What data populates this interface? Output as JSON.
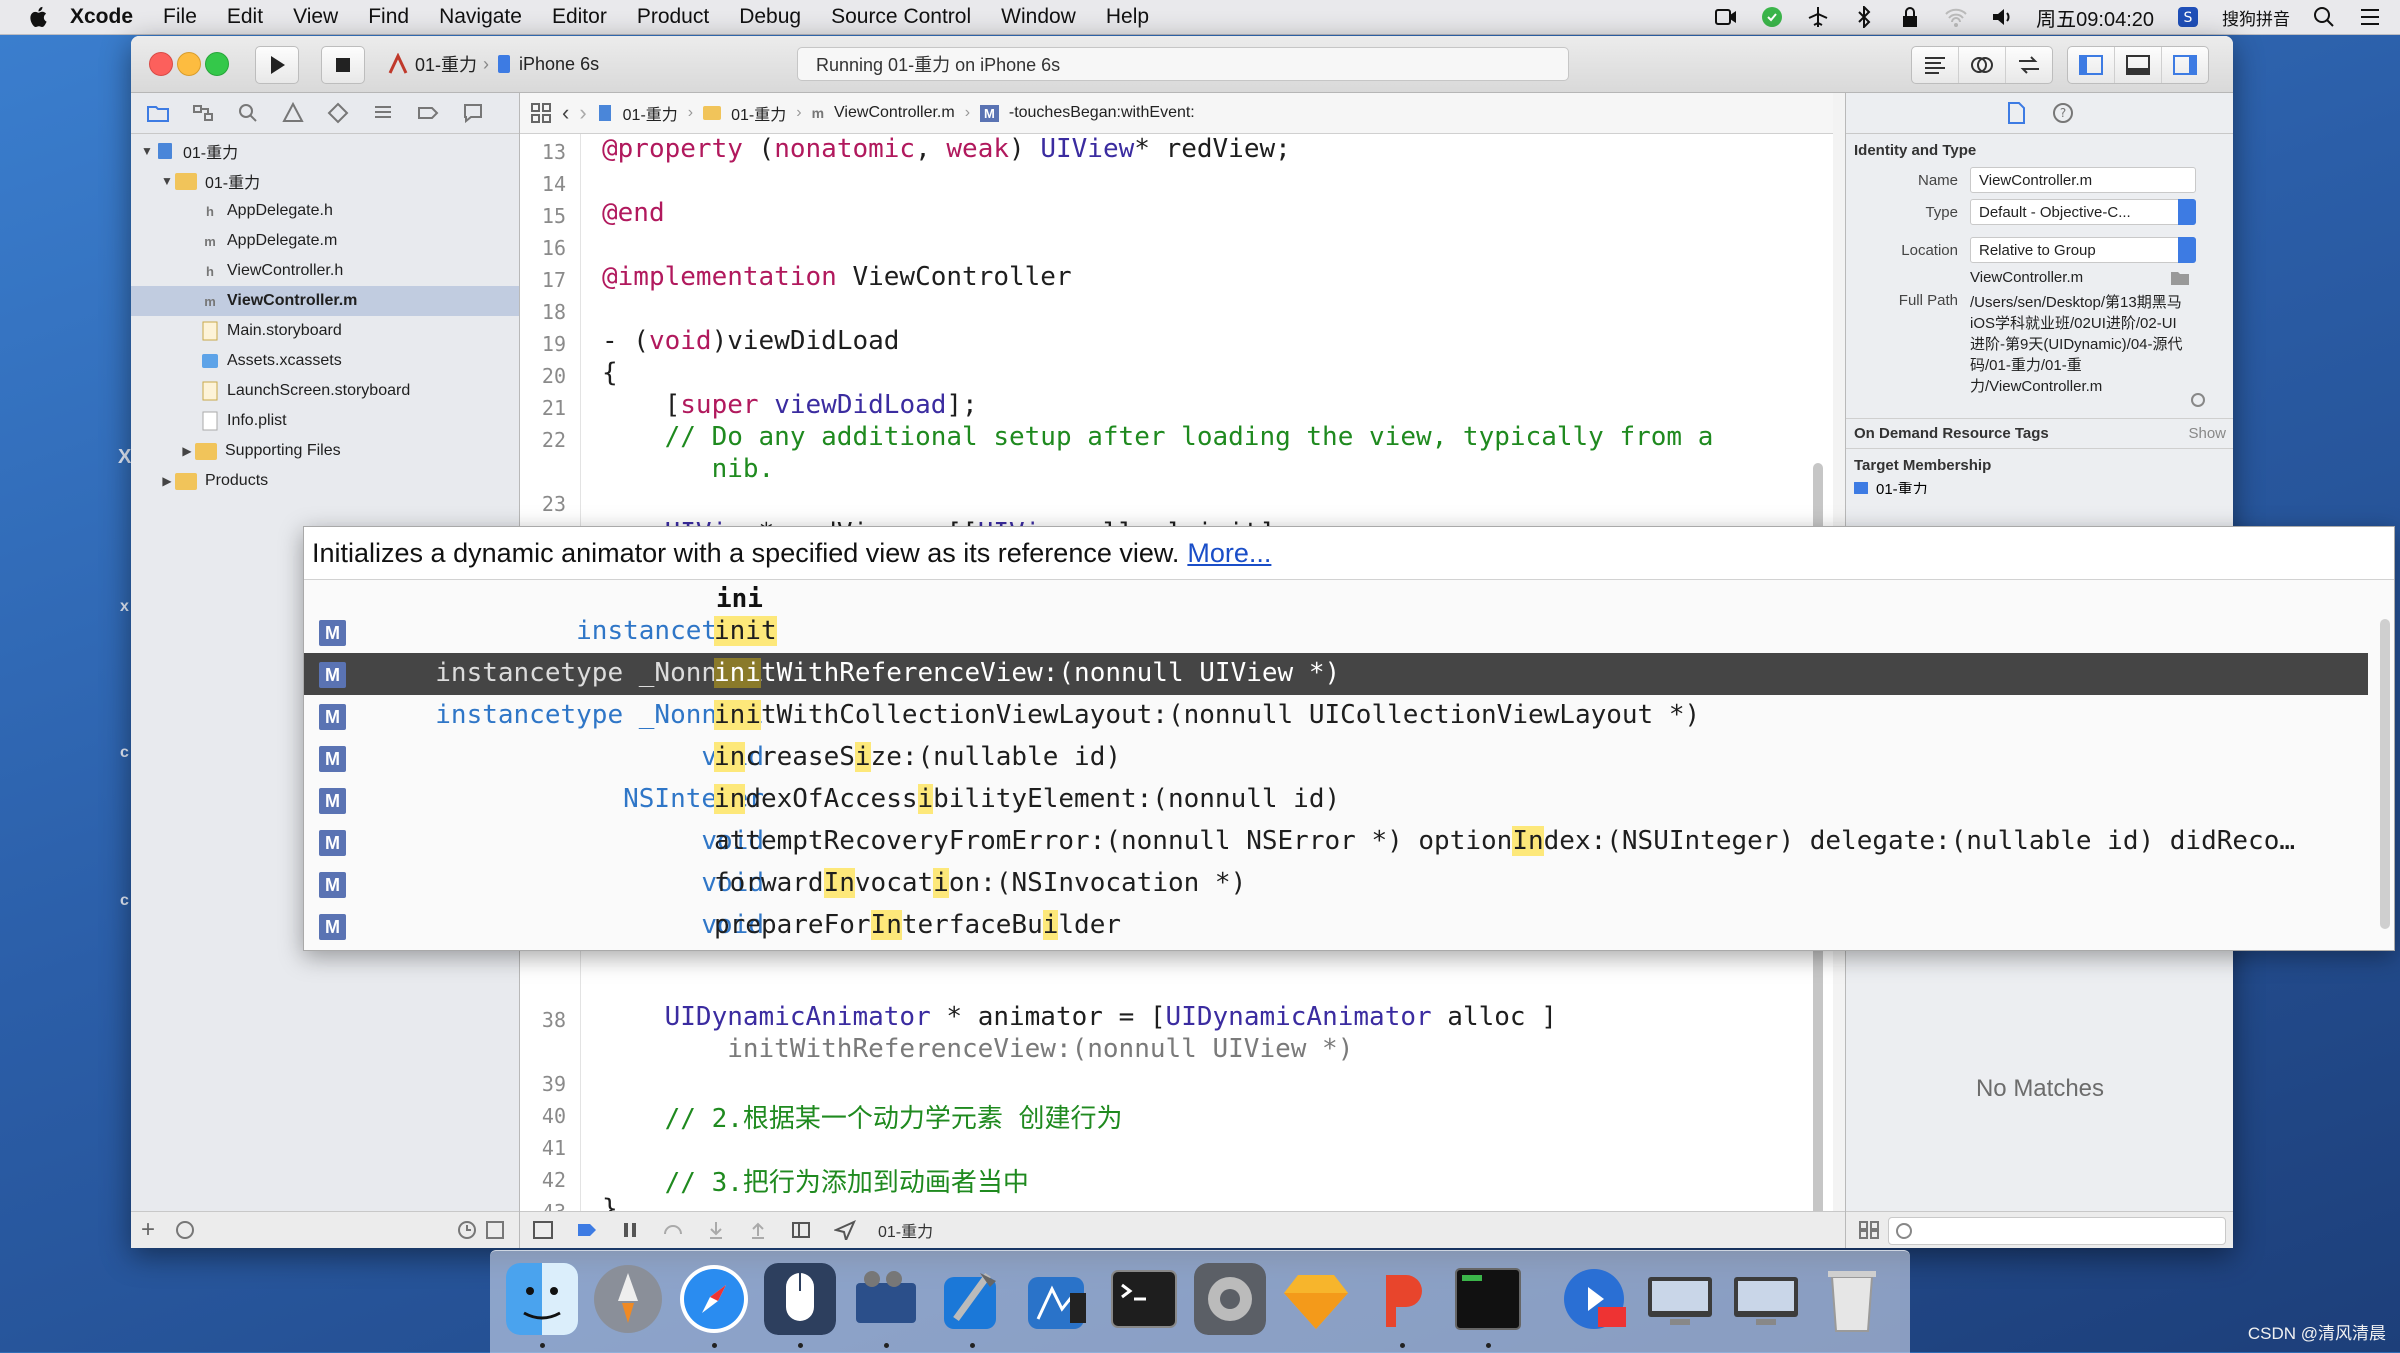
{
  "menubar": {
    "items": [
      "Xcode",
      "File",
      "Edit",
      "View",
      "Find",
      "Navigate",
      "Editor",
      "Product",
      "Debug",
      "Source Control",
      "Window",
      "Help"
    ],
    "clock": "周五09:04:20",
    "ime": "搜狗拼音"
  },
  "toolbar": {
    "scheme": "01-重力",
    "device": "iPhone 6s",
    "activity": "Running 01-重力 on iPhone 6s"
  },
  "navigator": {
    "items": [
      {
        "label": "01-重力",
        "kind": "project",
        "expanded": true
      },
      {
        "label": "01-重力",
        "kind": "group",
        "expanded": true
      },
      {
        "label": "AppDelegate.h",
        "kind": "h"
      },
      {
        "label": "AppDelegate.m",
        "kind": "m"
      },
      {
        "label": "ViewController.h",
        "kind": "h"
      },
      {
        "label": "ViewController.m",
        "kind": "m",
        "selected": true
      },
      {
        "label": "Main.storyboard",
        "kind": "storyboard"
      },
      {
        "label": "Assets.xcassets",
        "kind": "assets"
      },
      {
        "label": "LaunchScreen.storyboard",
        "kind": "storyboard"
      },
      {
        "label": "Info.plist",
        "kind": "plist"
      },
      {
        "label": "Supporting Files",
        "kind": "folder"
      },
      {
        "label": "Products",
        "kind": "folder"
      }
    ]
  },
  "jumpbar": {
    "crumbs": [
      "01-重力",
      "01-重力",
      "ViewController.m",
      "-touchesBegan:withEvent:"
    ]
  },
  "editor": {
    "lines": [
      {
        "n": "13",
        "text": "@property (nonatomic, weak) UIView* redView;"
      },
      {
        "n": "14",
        "text": ""
      },
      {
        "n": "15",
        "text": "@end"
      },
      {
        "n": "16",
        "text": ""
      },
      {
        "n": "17",
        "text": "@implementation ViewController"
      },
      {
        "n": "18",
        "text": ""
      },
      {
        "n": "19",
        "text": "- (void)viewDidLoad"
      },
      {
        "n": "20",
        "text": "{"
      },
      {
        "n": "21",
        "text": "    [super viewDidLoad];"
      },
      {
        "n": "22",
        "text": "    // Do any additional setup after loading the view, typically from a"
      },
      {
        "n": "",
        "text": "       nib."
      },
      {
        "n": "23",
        "text": ""
      },
      {
        "n": "24",
        "text": "    UIView* redView = [[UIView alloc] init];"
      },
      {
        "n": "38",
        "text": "    UIDynamicAnimator * animator = [UIDynamicAnimator alloc ]"
      },
      {
        "n": "",
        "text": "        initWithReferenceView:(nonnull UIView *)"
      },
      {
        "n": "39",
        "text": ""
      },
      {
        "n": "40",
        "text": "    // 2.根据某一个动力学元素 创建行为"
      },
      {
        "n": "41",
        "text": ""
      },
      {
        "n": "42",
        "text": "    // 3.把行为添加到动画者当中"
      },
      {
        "n": "43",
        "text": "}"
      },
      {
        "n": "44",
        "text": ""
      }
    ],
    "bottom_target": "01-重力"
  },
  "completion": {
    "doc": "Initializes a dynamic animator with a specified view as its reference view.",
    "more": "More...",
    "prefix": "ini",
    "items": [
      {
        "ret": "instancetype",
        "sig": "init"
      },
      {
        "ret": "instancetype _Nonnull",
        "sig": "initWithReferenceView:(nonnull UIView *)",
        "selected": true
      },
      {
        "ret": "instancetype _Nonnull",
        "sig": "initWithCollectionViewLayout:(nonnull UICollectionViewLayout *)"
      },
      {
        "ret": "void",
        "sig": "increaseSize:(nullable id)"
      },
      {
        "ret": "NSInteger",
        "sig": "indexOfAccessibilityElement:(nonnull id)"
      },
      {
        "ret": "void",
        "sig": "attemptRecoveryFromError:(nonnull NSError *) optionIndex:(NSUInteger) delegate:(nullable id) didReco…"
      },
      {
        "ret": "void",
        "sig": "forwardInvocation:(NSInvocation *)"
      },
      {
        "ret": "void",
        "sig": "prepareForInterfaceBuilder"
      }
    ]
  },
  "inspector": {
    "section_identity": "Identity and Type",
    "name_label": "Name",
    "name_value": "ViewController.m",
    "type_label": "Type",
    "type_value": "Default - Objective-C...",
    "location_label": "Location",
    "location_value": "Relative to Group",
    "file_name": "ViewController.m",
    "full_path_label": "Full Path",
    "full_path": "/Users/sen/Desktop/第13期黑马iOS学科就业班/02UI进阶/02-UI进阶-第9天(UIDynamic)/04-源代码/01-重力/01-重力/ViewController.m",
    "on_demand": "On Demand Resource Tags",
    "show": "Show",
    "target_membership": "Target Membership",
    "target_item": "01-重力",
    "no_matches": "No Matches"
  },
  "watermark": "CSDN @清风清晨",
  "colors": {
    "accent": "#3d7be3",
    "keyword": "#b1195d",
    "comment": "#1f8a1f",
    "highlight": "#fde87a"
  }
}
